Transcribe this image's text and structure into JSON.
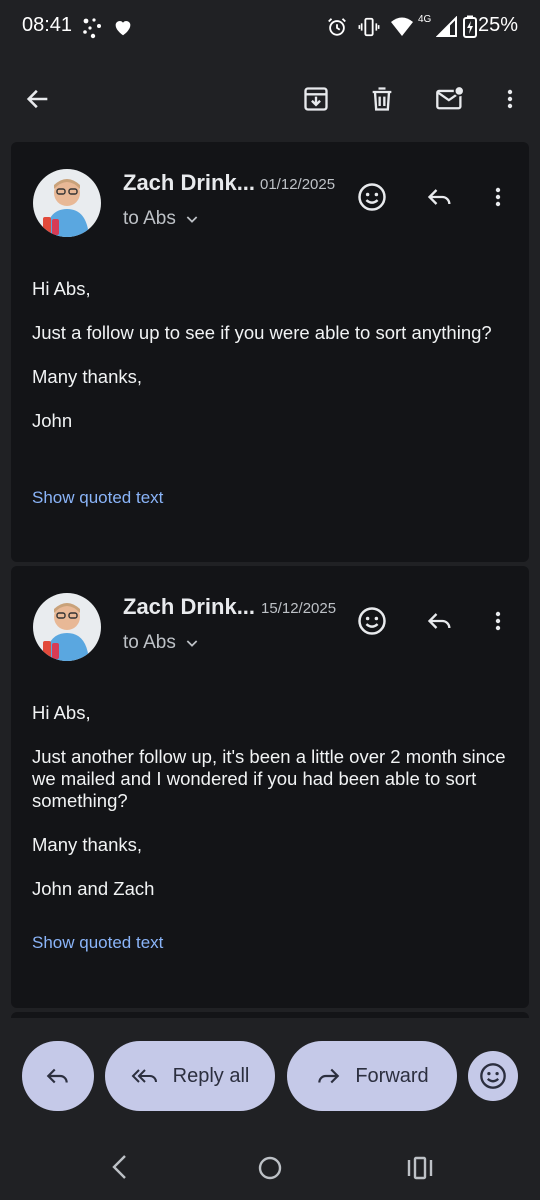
{
  "status": {
    "time": "08:41",
    "network": "4G",
    "battery": "25%"
  },
  "toolbar": {
    "icons": [
      "back-arrow-icon",
      "archive-icon",
      "delete-icon",
      "mark-unread-icon",
      "more-vert-icon"
    ]
  },
  "messages": [
    {
      "sender": "Zach Drink...",
      "date": "01/12/2025",
      "to": "to Abs",
      "body": [
        "Hi Abs,",
        "Just a follow up to see if you were able to sort anything?",
        "Many thanks,",
        "John"
      ],
      "quoted": "Show quoted text"
    },
    {
      "sender": "Zach Drink...",
      "date": "15/12/2025",
      "to": "to Abs",
      "body": [
        "Hi Abs,",
        "Just another follow up, it's been a little over 2 month since we mailed and I wondered if you had been able to sort something?",
        "Many thanks,",
        "John and Zach"
      ],
      "quoted": "Show quoted text"
    }
  ],
  "actions": {
    "reply_all": "Reply all",
    "forward": "Forward"
  }
}
